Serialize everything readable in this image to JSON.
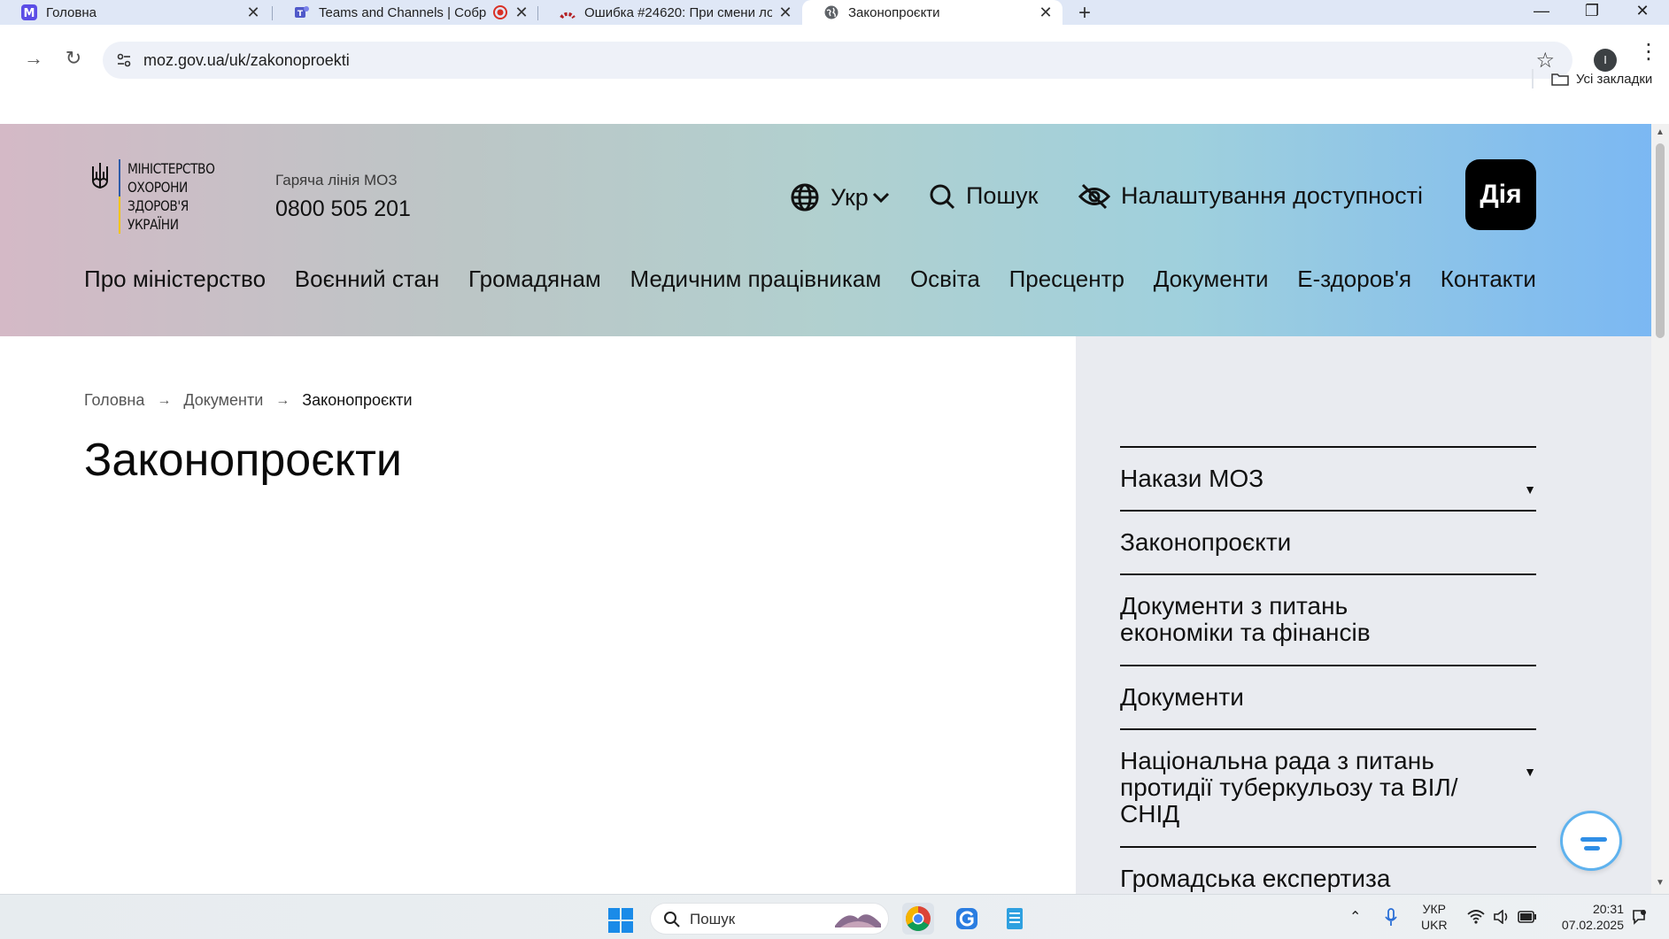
{
  "browser": {
    "tabs": [
      {
        "title": "Головна",
        "favicon": "m-app-icon",
        "active": false
      },
      {
        "title": "Teams and Channels | Собр",
        "favicon": "teams-icon",
        "active": false
      },
      {
        "title": "Ошибка #24620: При смени ло",
        "favicon": "redmine-icon",
        "active": false
      },
      {
        "title": "Законопроєкти",
        "favicon": "globe-icon",
        "active": true
      }
    ],
    "new_tab": "+",
    "url": "moz.gov.ua/uk/zakonoproekti",
    "profile_initial": "I",
    "bookmarks_label": "Усі закладки"
  },
  "header": {
    "logo_lines": [
      "МІНІСТЕРСТВО",
      "ОХОРОНИ",
      "ЗДОРОВ'Я",
      "УКРАЇНИ"
    ],
    "hotline_label": "Гаряча лінія МОЗ",
    "hotline_number": "0800 505 201",
    "language": "Укр",
    "search": "Пошук",
    "accessibility": "Налаштування доступності",
    "diia": "Дія",
    "nav": [
      "Про міністерство",
      "Воєнний стан",
      "Громадянам",
      "Медичним працівникам",
      "Освіта",
      "Пресцентр",
      "Документи",
      "Е-здоров'я",
      "Контакти"
    ]
  },
  "breadcrumb": [
    "Головна",
    "Документи",
    "Законопроєкти"
  ],
  "page_title": "Законопроєкти",
  "sidebar": {
    "items": [
      {
        "label": "Накази МОЗ",
        "has_caret": true
      },
      {
        "label": "Законопроєкти",
        "has_caret": false
      },
      {
        "label": "Документи з питань економіки та фінансів",
        "has_caret": false
      },
      {
        "label": "Документи",
        "has_caret": false
      },
      {
        "label": "Національна рада з питань протидії туберкульозу та ВІЛ/СНІД",
        "has_caret": true
      },
      {
        "label": "Громадська експертиза",
        "has_caret": false
      }
    ]
  },
  "taskbar": {
    "search": "Пошук",
    "lang_top": "УКР",
    "lang_bottom": "UKR",
    "time": "20:31",
    "date": "07.02.2025"
  },
  "colors": {
    "header_gradient_start": "#d4b9c6",
    "header_gradient_end": "#7bb8f3",
    "sidebar_bg": "#e9ebf0",
    "chat_accent": "#2f8ee6"
  }
}
